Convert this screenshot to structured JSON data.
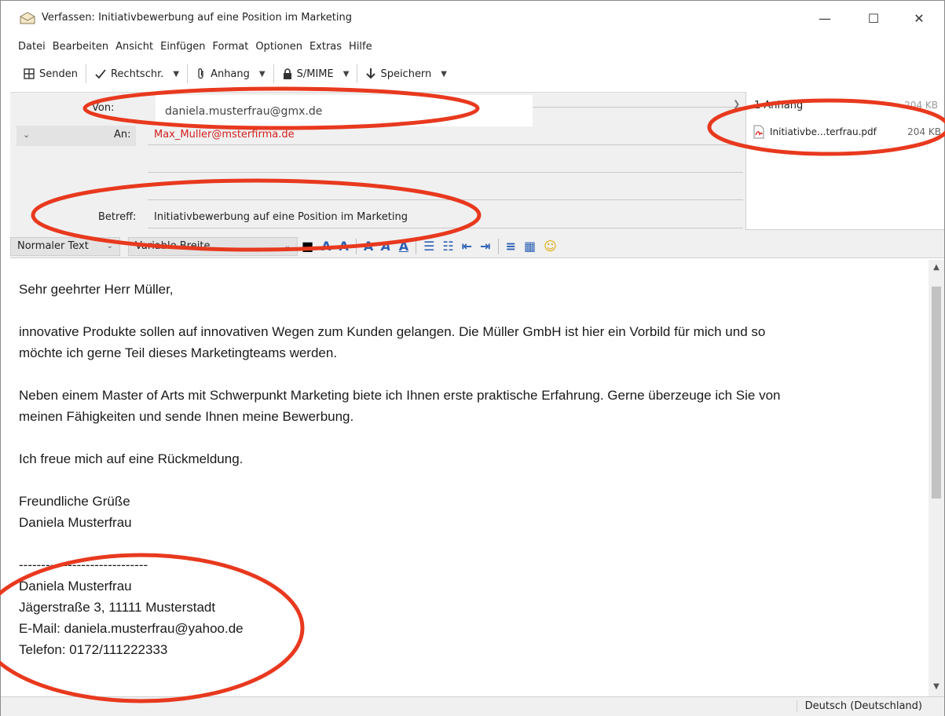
{
  "window": {
    "title": "Verfassen: Initiativbewerbung auf eine Position im Marketing",
    "minimize": "—",
    "maximize": "☐",
    "close": "✕"
  },
  "menu": [
    "Datei",
    "Bearbeiten",
    "Ansicht",
    "Einfügen",
    "Format",
    "Optionen",
    "Extras",
    "Hilfe"
  ],
  "toolbar": {
    "send": "Senden",
    "spell": "Rechtschr.",
    "attach": "Anhang",
    "smime": "S/MIME",
    "save": "Speichern"
  },
  "header": {
    "from_label": "Von:",
    "from_value": "daniela.musterfrau@gmx.de",
    "to_label": "An:",
    "to_value": "Max_Muller@msterfirma.de",
    "subject_label": "Betreff:",
    "subject_value": "Initiativbewerbung auf eine Position im Marketing"
  },
  "attachments": {
    "header": "1 Anhang",
    "header_size": "204 KB",
    "items": [
      {
        "name": "Initiativbe...terfrau.pdf",
        "size": "204 KB"
      }
    ]
  },
  "format_bar": {
    "paragraph": "Normaler Text",
    "font": "Variable Breite"
  },
  "body": {
    "greeting": "Sehr geehrter Herr Müller,",
    "p1_line1": "innovative Produkte sollen auf innovativen Wegen zum Kunden gelangen. Die Müller GmbH ist hier ein Vorbild für mich und so",
    "p1_line2": "möchte ich gerne Teil dieses Marketingteams werden.",
    "p2_line1": "Neben einem Master of Arts mit Schwerpunkt Marketing biete ich Ihnen erste praktische Erfahrung. Gerne überzeuge ich Sie von",
    "p2_line2": "meinen Fähigkeiten und sende Ihnen meine Bewerbung.",
    "p3": "Ich freue mich auf eine Rückmeldung.",
    "closing": "Freundliche Grüße",
    "name": "Daniela Musterfrau",
    "sig_divider": "-----------------------------",
    "sig_name": "Daniela Musterfrau",
    "sig_address": "Jägerstraße 3, 11111 Musterstadt",
    "sig_email": "E-Mail: daniela.musterfrau@yahoo.de",
    "sig_phone": "Telefon: 0172/111222333"
  },
  "status": {
    "language": "Deutsch (Deutschland)"
  },
  "colors": {
    "annotation": "#e8391e",
    "recipient": "#d42020"
  }
}
